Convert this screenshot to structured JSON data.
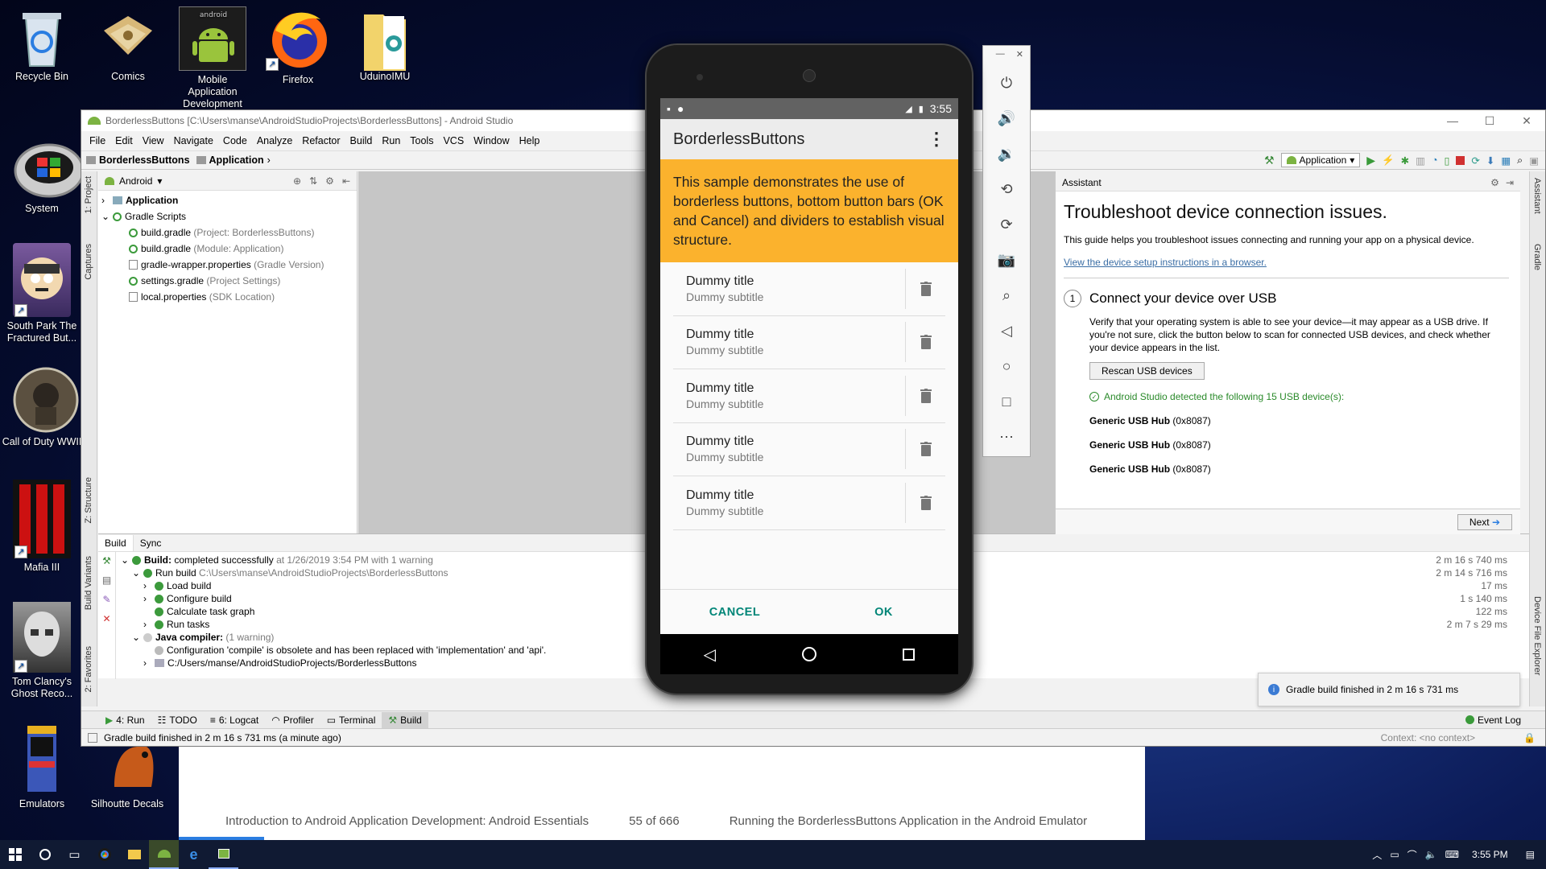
{
  "desktop": {
    "icons": [
      {
        "label": "Recycle Bin",
        "icon": "recycle-bin-icon"
      },
      {
        "label": "Comics",
        "icon": "folder-icon"
      },
      {
        "label": "Mobile Application Development",
        "icon": "android-icon"
      },
      {
        "label": "Firefox",
        "icon": "firefox-icon"
      },
      {
        "label": "UduinoIMU",
        "icon": "folder-icon"
      },
      {
        "label": "System",
        "icon": "windows-icon"
      },
      {
        "label": "South Park The Fractured But...",
        "icon": "game-icon"
      },
      {
        "label": "Call of Duty WWII",
        "icon": "game-icon"
      },
      {
        "label": "Mafia III",
        "icon": "game-icon"
      },
      {
        "label": "Tom Clancy's Ghost Reco...",
        "icon": "game-icon"
      },
      {
        "label": "Emulators",
        "icon": "arcade-icon"
      },
      {
        "label": "Silhoutte Decals",
        "icon": "cat-icon"
      }
    ]
  },
  "studio": {
    "title": "BorderlessButtons [C:\\Users\\manse\\AndroidStudioProjects\\BorderlessButtons] - Android Studio",
    "menu": [
      "File",
      "Edit",
      "View",
      "Navigate",
      "Code",
      "Analyze",
      "Refactor",
      "Build",
      "Run",
      "Tools",
      "VCS",
      "Window",
      "Help"
    ],
    "breadcrumb": [
      "BorderlessButtons",
      "Application"
    ],
    "run_config": "Application",
    "project_view": "Android",
    "left_tabs": [
      "1: Project",
      "Captures",
      "Z: Structure",
      "Build Variants",
      "2: Favorites"
    ],
    "right_tabs": [
      "Assistant",
      "Gradle",
      "Device File Explorer"
    ],
    "tree": [
      {
        "name": "Application",
        "note": "",
        "bold": true
      },
      {
        "name": "Gradle Scripts",
        "note": "",
        "bold": false
      },
      {
        "name": "build.gradle",
        "note": "(Project: BorderlessButtons)"
      },
      {
        "name": "build.gradle",
        "note": "(Module: Application)"
      },
      {
        "name": "gradle-wrapper.properties",
        "note": "(Gradle Version)"
      },
      {
        "name": "settings.gradle",
        "note": "(Project Settings)"
      },
      {
        "name": "local.properties",
        "note": "(SDK Location)"
      }
    ],
    "build_tabs": [
      "Build",
      "Sync"
    ],
    "build": {
      "status_label": "Build:",
      "status": "completed successfully",
      "when": "at 1/26/2019 3:54 PM",
      "warn": "with 1 warning",
      "run_build": "Run build",
      "run_build_path": "C:\\Users\\manse\\AndroidStudioProjects\\BorderlessButtons",
      "steps": [
        "Load build",
        "Configure build",
        "Calculate task graph",
        "Run tasks"
      ],
      "java": "Java compiler:",
      "java_warn": "(1 warning)",
      "warning": "Configuration 'compile' is obsolete and has been replaced with 'implementation' and 'api'.",
      "path": "C:/Users/manse/AndroidStudioProjects/BorderlessButtons",
      "times": [
        "2 m 16 s 740 ms",
        "2 m 14 s 716 ms",
        "17 ms",
        "1 s 140 ms",
        "122 ms",
        "2 m 7 s 29 ms"
      ]
    },
    "bottom_tabs": [
      "4: Run",
      "TODO",
      "6: Logcat",
      "Profiler",
      "Terminal",
      "Build"
    ],
    "event_log": "Event Log",
    "status_bar": "Gradle build finished in 2 m 16 s 731 ms (a minute ago)",
    "context": "Context: <no context>",
    "notification": "Gradle build finished in 2 m 16 s 731 ms",
    "assistant": {
      "header": "Assistant",
      "title": "Troubleshoot device connection issues.",
      "intro": "This guide helps you troubleshoot issues connecting and running your app on a physical device.",
      "link": "View the device setup instructions in a browser.",
      "step_num": "1",
      "step_title": "Connect your device over USB",
      "step_text": "Verify that your operating system is able to see your device—it may appear as a USB drive. If you're not sure, click the button below to scan for connected USB devices, and check whether your device appears in the list.",
      "rescan": "Rescan USB devices",
      "detected": "Android Studio detected the following 15 USB device(s):",
      "devices": [
        {
          "name": "Generic USB Hub",
          "id": "(0x8087)"
        },
        {
          "name": "Generic USB Hub",
          "id": "(0x8087)"
        },
        {
          "name": "Generic USB Hub",
          "id": "(0x8087)"
        }
      ],
      "next": "Next"
    }
  },
  "phone": {
    "time": "3:55",
    "app_title": "BorderlessButtons",
    "intro": "This sample demonstrates the use of borderless buttons, bottom button bars (OK and Cancel) and dividers to establish visual structure.",
    "items": [
      {
        "title": "Dummy title",
        "subtitle": "Dummy subtitle"
      },
      {
        "title": "Dummy title",
        "subtitle": "Dummy subtitle"
      },
      {
        "title": "Dummy title",
        "subtitle": "Dummy subtitle"
      },
      {
        "title": "Dummy title",
        "subtitle": "Dummy subtitle"
      },
      {
        "title": "Dummy title",
        "subtitle": "Dummy subtitle"
      }
    ],
    "cancel": "CANCEL",
    "ok": "OK",
    "accent": "#fbb22d",
    "button_color": "#008577"
  },
  "reader": {
    "book": "Introduction to Android Application Development: Android Essentials",
    "page": "55 of 666",
    "section": "Running the BorderlessButtons Application in the Android Emulator"
  },
  "taskbar": {
    "time": "3:55 PM"
  }
}
